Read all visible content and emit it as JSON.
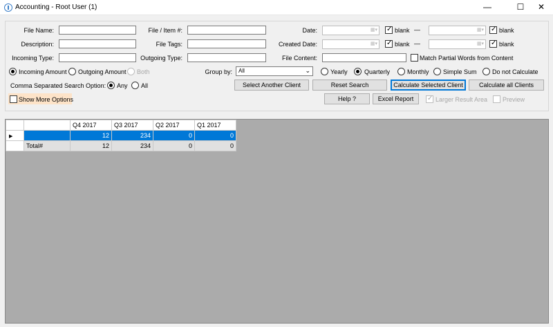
{
  "window": {
    "title": "Accounting - Root User (1)",
    "minimize_glyph": "—",
    "maximize_glyph": "☐",
    "close_glyph": "✕"
  },
  "form": {
    "file_name_label": "File Name:",
    "file_item_label": "File / Item #:",
    "date_label": "Date:",
    "description_label": "Description:",
    "file_tags_label": "File Tags:",
    "created_date_label": "Created Date:",
    "incoming_type_label": "Incoming Type:",
    "outgoing_type_label": "Outgoing Type:",
    "file_content_label": "File Content:",
    "blank_label": "blank",
    "dash": "—",
    "match_partial_label": "Match Partial Words from Content",
    "incoming_amount_label": "Incoming Amount",
    "outgoing_amount_label": "Outgoing Amount",
    "both_label": "Both",
    "group_by_label": "Group by:",
    "group_by_value": "All",
    "yearly_label": "Yearly",
    "quarterly_label": "Quarterly",
    "monthly_label": "Monthly",
    "simple_sum_label": "Simple Sum",
    "do_not_calc_label": "Do not Calculate",
    "comma_sep_label": "Comma Separated Search Option:",
    "any_label": "Any",
    "all_label": "All",
    "show_more_label": "Show More Options",
    "larger_result_label": "Larger Result Area",
    "preview_label": "Preview"
  },
  "buttons": {
    "select_another_client": "Select Another Client",
    "reset_search": "Reset Search",
    "calculate_selected_client": "Calculate Selected Client",
    "calculate_all_clients": "Calculate all Clients",
    "help": "Help ?",
    "excel_report": "Excel Report"
  },
  "grid": {
    "columns": [
      "",
      "Q4 2017",
      "Q3 2017",
      "Q2 2017",
      "Q1 2017"
    ],
    "rows": [
      {
        "label": "",
        "values": [
          "12",
          "234",
          "0",
          "0"
        ],
        "selected": true
      },
      {
        "label": "Total#",
        "values": [
          "12",
          "234",
          "0",
          "0"
        ],
        "selected": false
      }
    ],
    "row_marker": "▶"
  }
}
